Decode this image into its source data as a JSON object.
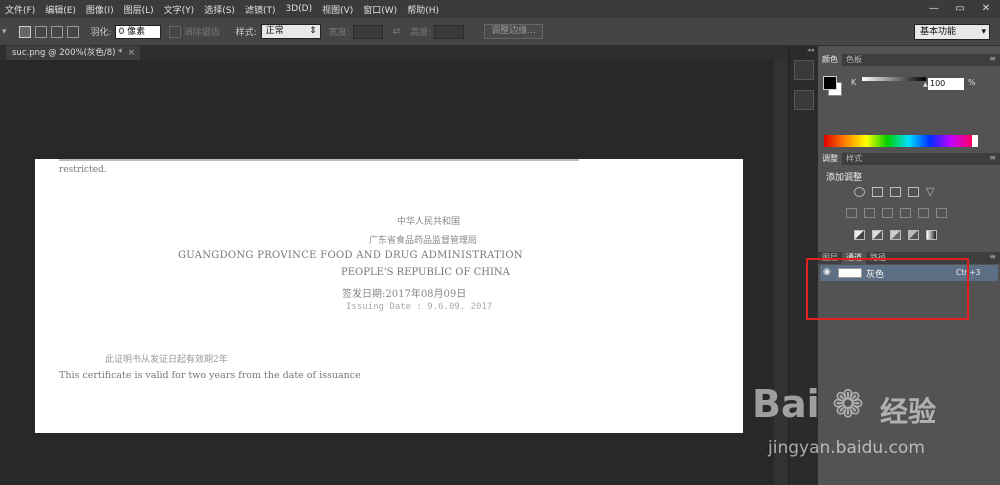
{
  "menubar": {
    "items": [
      "文件(F)",
      "编辑(E)",
      "图像(I)",
      "图层(L)",
      "文字(Y)",
      "选择(S)",
      "滤镜(T)",
      "3D(D)",
      "视图(V)",
      "窗口(W)",
      "帮助(H)"
    ],
    "minimize": "—",
    "restore": "▭",
    "close": "✕"
  },
  "options": {
    "feather_label": "羽化:",
    "feather_value": "0 像素",
    "antialias_label": "消除锯齿",
    "style_label": "样式:",
    "style_value": "正常",
    "width_label": "宽度:",
    "height_label": "高度:",
    "refine_edge_label": "调整边缘...",
    "workspace_value": "基本功能"
  },
  "document": {
    "tab_title": "suc.png @ 200%(灰色/8) *",
    "close": "×"
  },
  "image_content": {
    "line_restricted": "restricted.",
    "line_prc_cn": "中华人民共和国",
    "line_agency_cn": "广东省食品药品监督管理局",
    "line_agency_en": "GUANGDONG PROVINCE FOOD AND DRUG ADMINISTRATION",
    "line_prc_en": "PEOPLE'S REPUBLIC OF CHINA",
    "line_issue_cn": "签发日期:2017年08月09日",
    "line_issue_en": "Issuing Date : 9.6.09. 2017",
    "line_valid_cn": "此证明书从发证日起有效期2年",
    "line_valid_en": "This certificate is valid for two years from the date of issuance"
  },
  "color_panel": {
    "tabs": [
      "颜色",
      "色板"
    ],
    "channel_label": "K",
    "channel_value": "100",
    "unit": "%"
  },
  "adjustments_panel": {
    "tabs": [
      "调整",
      "样式"
    ],
    "title": "添加调整"
  },
  "layers_panel": {
    "tabs": [
      "图层",
      "通道",
      "路径"
    ],
    "layer_name": "灰色",
    "shortcut": "Ctrl+3"
  },
  "watermark": {
    "brand_left": "Bai",
    "brand_right": "经验",
    "url": "jingyan.baidu.com"
  },
  "colors": {
    "selection_highlight": "#5d6f84",
    "annotation_red": "#e12020"
  }
}
